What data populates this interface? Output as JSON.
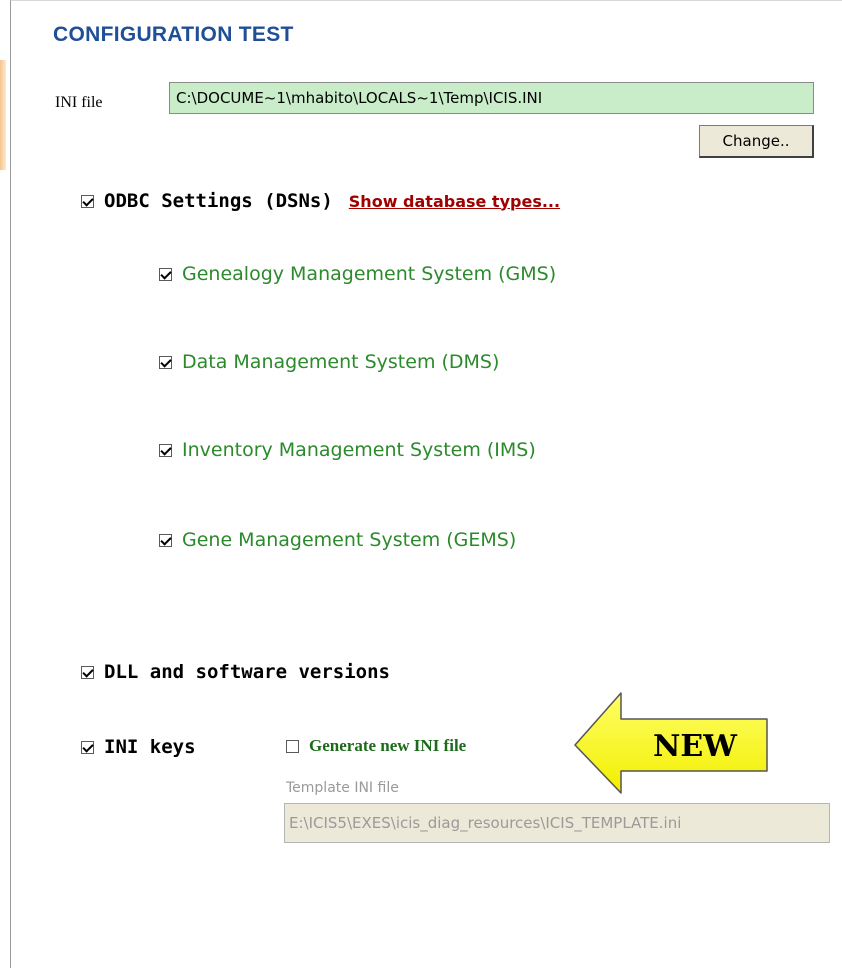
{
  "title": "CONFIGURATION TEST",
  "ini_file": {
    "label": "INI file",
    "value": "C:\\DOCUME~1\\mhabito\\LOCALS~1\\Temp\\ICIS.INI",
    "change_button": "Change.."
  },
  "odbc": {
    "label": "ODBC Settings (DSNs)",
    "checked": true,
    "link": "Show database types...",
    "systems": [
      {
        "label": "Genealogy Management System (GMS)",
        "checked": true
      },
      {
        "label": "Data Management System (DMS)",
        "checked": true
      },
      {
        "label": "Inventory Management System (IMS)",
        "checked": true
      },
      {
        "label": "Gene Management System (GEMS)",
        "checked": true
      }
    ]
  },
  "dll": {
    "label": "DLL and software versions",
    "checked": true
  },
  "ini_keys": {
    "label": "INI keys",
    "checked": true,
    "generate_label": "Generate new INI file",
    "generate_checked": false,
    "template_label": "Template INI file",
    "template_value": "E:\\ICIS5\\EXES\\icis_diag_resources\\ICIS_TEMPLATE.ini"
  },
  "callout": {
    "text": "NEW",
    "color": "#ffff00"
  },
  "colors": {
    "title": "#1f4f96",
    "system_text": "#2b8a2b",
    "link": "#a00000",
    "ini_field_bg": "#c9ecc9"
  }
}
